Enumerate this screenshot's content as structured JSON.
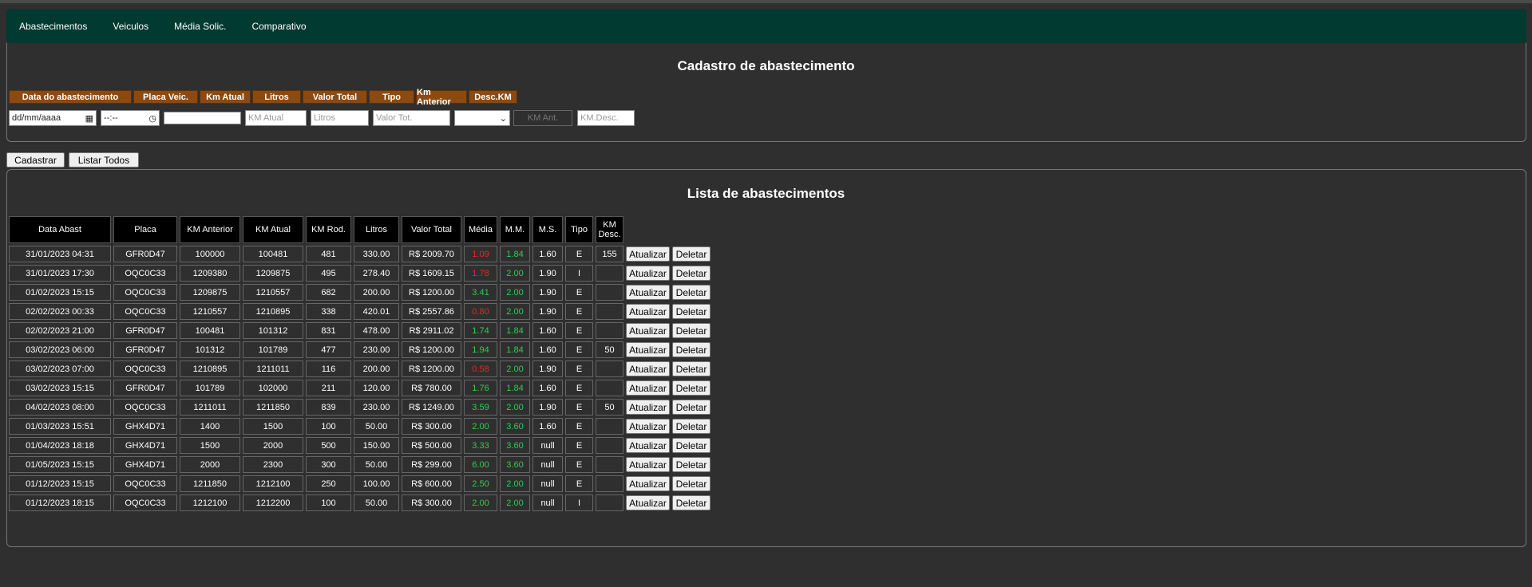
{
  "nav": [
    "Abastecimentos",
    "Veiculos",
    "Média Solic.",
    "Comparativo"
  ],
  "form": {
    "title": "Cadastro de abastecimento",
    "headers": [
      "Data do abastecimento",
      "Placa Veic.",
      "Km Atual",
      "Litros",
      "Valor Total",
      "Tipo",
      "Km Anterior",
      "Desc.KM"
    ],
    "date_placeholder": "dd/mm/aaaa",
    "time_placeholder": "--:--",
    "km_atual_placeholder": "KM Atual",
    "litros_placeholder": "Litros",
    "valor_placeholder": "Valor Tot.",
    "km_ant_placeholder": "KM Ant.",
    "km_desc_placeholder": "KM.Desc."
  },
  "buttons": {
    "cadastrar": "Cadastrar",
    "listar": "Listar Todos",
    "atualizar": "Atualizar",
    "deletar": "Deletar"
  },
  "list": {
    "title": "Lista de abastecimentos",
    "columns": [
      "Data Abast",
      "Placa",
      "KM Anterior",
      "KM Atual",
      "KM Rod.",
      "Litros",
      "Valor Total",
      "Média",
      "M.M.",
      "M.S.",
      "Tipo",
      "KM Desc."
    ],
    "rows": [
      {
        "data": "31/01/2023 04:31",
        "placa": "GFR0D47",
        "km_ant": "100000",
        "km_atual": "100481",
        "km_rod": "481",
        "litros": "330.00",
        "valor": "R$ 2009.70",
        "media": "1.09",
        "media_status": "bad",
        "mm": "1.84",
        "ms": "1.60",
        "tipo": "E",
        "km_desc": "155"
      },
      {
        "data": "31/01/2023 17:30",
        "placa": "OQC0C33",
        "km_ant": "1209380",
        "km_atual": "1209875",
        "km_rod": "495",
        "litros": "278.40",
        "valor": "R$ 1609.15",
        "media": "1.78",
        "media_status": "bad",
        "mm": "2.00",
        "ms": "1.90",
        "tipo": "I",
        "km_desc": ""
      },
      {
        "data": "01/02/2023 15:15",
        "placa": "OQC0C33",
        "km_ant": "1209875",
        "km_atual": "1210557",
        "km_rod": "682",
        "litros": "200.00",
        "valor": "R$ 1200.00",
        "media": "3.41",
        "media_status": "good",
        "mm": "2.00",
        "ms": "1.90",
        "tipo": "E",
        "km_desc": ""
      },
      {
        "data": "02/02/2023 00:33",
        "placa": "OQC0C33",
        "km_ant": "1210557",
        "km_atual": "1210895",
        "km_rod": "338",
        "litros": "420.01",
        "valor": "R$ 2557.86",
        "media": "0.80",
        "media_status": "bad",
        "mm": "2.00",
        "ms": "1.90",
        "tipo": "E",
        "km_desc": ""
      },
      {
        "data": "02/02/2023 21:00",
        "placa": "GFR0D47",
        "km_ant": "100481",
        "km_atual": "101312",
        "km_rod": "831",
        "litros": "478.00",
        "valor": "R$ 2911.02",
        "media": "1.74",
        "media_status": "good",
        "mm": "1.84",
        "ms": "1.60",
        "tipo": "E",
        "km_desc": ""
      },
      {
        "data": "03/02/2023 06:00",
        "placa": "GFR0D47",
        "km_ant": "101312",
        "km_atual": "101789",
        "km_rod": "477",
        "litros": "230.00",
        "valor": "R$ 1200.00",
        "media": "1.94",
        "media_status": "good",
        "mm": "1.84",
        "ms": "1.60",
        "tipo": "E",
        "km_desc": "50"
      },
      {
        "data": "03/02/2023 07:00",
        "placa": "OQC0C33",
        "km_ant": "1210895",
        "km_atual": "1211011",
        "km_rod": "116",
        "litros": "200.00",
        "valor": "R$ 1200.00",
        "media": "0.58",
        "media_status": "bad",
        "mm": "2.00",
        "ms": "1.90",
        "tipo": "E",
        "km_desc": ""
      },
      {
        "data": "03/02/2023 15:15",
        "placa": "GFR0D47",
        "km_ant": "101789",
        "km_atual": "102000",
        "km_rod": "211",
        "litros": "120.00",
        "valor": "R$ 780.00",
        "media": "1.76",
        "media_status": "good",
        "mm": "1.84",
        "ms": "1.60",
        "tipo": "E",
        "km_desc": ""
      },
      {
        "data": "04/02/2023 08:00",
        "placa": "OQC0C33",
        "km_ant": "1211011",
        "km_atual": "1211850",
        "km_rod": "839",
        "litros": "230.00",
        "valor": "R$ 1249.00",
        "media": "3.59",
        "media_status": "good",
        "mm": "2.00",
        "ms": "1.90",
        "tipo": "E",
        "km_desc": "50"
      },
      {
        "data": "01/03/2023 15:51",
        "placa": "GHX4D71",
        "km_ant": "1400",
        "km_atual": "1500",
        "km_rod": "100",
        "litros": "50.00",
        "valor": "R$ 300.00",
        "media": "2.00",
        "media_status": "good",
        "mm": "3.60",
        "ms": "1.60",
        "tipo": "E",
        "km_desc": ""
      },
      {
        "data": "01/04/2023 18:18",
        "placa": "GHX4D71",
        "km_ant": "1500",
        "km_atual": "2000",
        "km_rod": "500",
        "litros": "150.00",
        "valor": "R$ 500.00",
        "media": "3.33",
        "media_status": "good",
        "mm": "3.60",
        "ms": "null",
        "tipo": "E",
        "km_desc": ""
      },
      {
        "data": "01/05/2023 15:15",
        "placa": "GHX4D71",
        "km_ant": "2000",
        "km_atual": "2300",
        "km_rod": "300",
        "litros": "50.00",
        "valor": "R$ 299.00",
        "media": "6.00",
        "media_status": "good",
        "mm": "3.60",
        "ms": "null",
        "tipo": "E",
        "km_desc": ""
      },
      {
        "data": "01/12/2023 15:15",
        "placa": "OQC0C33",
        "km_ant": "1211850",
        "km_atual": "1212100",
        "km_rod": "250",
        "litros": "100.00",
        "valor": "R$ 600.00",
        "media": "2.50",
        "media_status": "good",
        "mm": "2.00",
        "ms": "null",
        "tipo": "E",
        "km_desc": ""
      },
      {
        "data": "01/12/2023 18:15",
        "placa": "OQC0C33",
        "km_ant": "1212100",
        "km_atual": "1212200",
        "km_rod": "100",
        "litros": "50.00",
        "valor": "R$ 300.00",
        "media": "2.00",
        "media_status": "good",
        "mm": "2.00",
        "ms": "null",
        "tipo": "I",
        "km_desc": ""
      }
    ]
  },
  "colors": {
    "nav_bg": "#013a30",
    "header_orange": "#8b4a12",
    "bad": "#e02a2a",
    "good": "#2ecc52"
  }
}
